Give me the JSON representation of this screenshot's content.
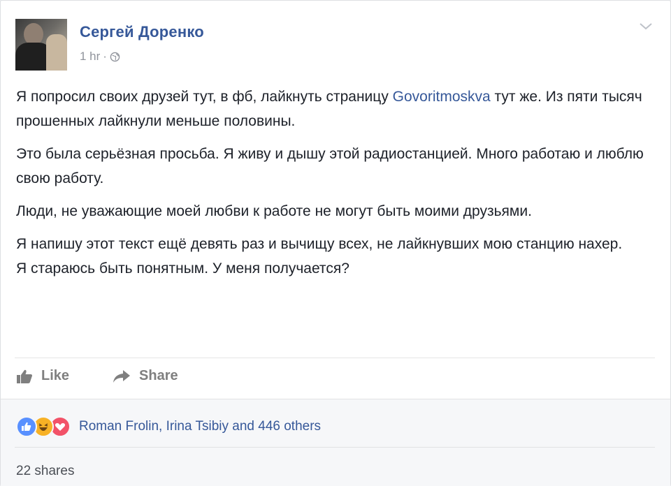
{
  "post": {
    "author": "Сергей Доренко",
    "time": "1 hr",
    "separator": "·",
    "paragraphs": [
      {
        "before": "Я попросил своих друзей тут, в фб, лайкнуть страницу ",
        "link": "Govoritmoskva",
        "after": " тут же. Из пяти тысяч прошенных лайкнули меньше половины."
      },
      {
        "text": "Это была серьёзная просьба. Я живу и дышу этой радиостанцией. Много работаю и люблю свою работу."
      },
      {
        "text": "Люди, не уважающие моей любви к работе не могут быть моими друзьями."
      }
    ],
    "last_paragraph_lines": [
      "Я напишу этот текст ещё девять раз и вычищу всех, не лайкнувших мою станцию нахер.",
      "Я стараюсь быть понятным. У меня получается?"
    ]
  },
  "actions": {
    "like": "Like",
    "share": "Share"
  },
  "footer": {
    "likers": "Roman Frolin, Irina Tsibiy and 446 others",
    "shares": "22 shares"
  },
  "icons": {
    "reactions": [
      "like-reaction-icon",
      "haha-reaction-icon",
      "love-reaction-icon"
    ],
    "colors": {
      "like": "#5890ff",
      "haha": "#f7b125",
      "love": "#f25268",
      "link": "#365899"
    }
  }
}
